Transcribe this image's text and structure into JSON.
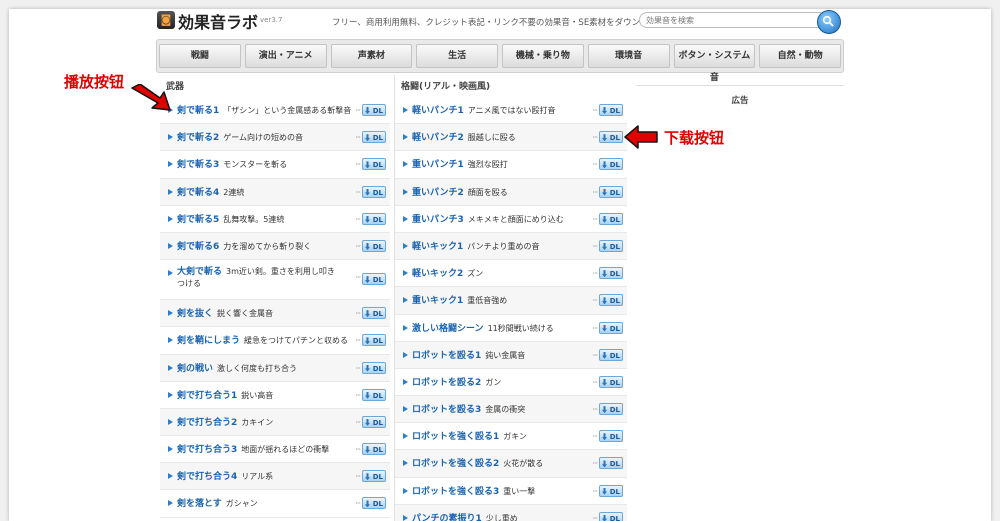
{
  "header": {
    "logo_glyph": "◙",
    "logo": "効果音ラボ",
    "version": "ver3.7",
    "tagline": "フリー、商用利用無料、クレジット表記・リンク不要の効果音・SE素材をダウンロード",
    "search_placeholder": "効果音を検索"
  },
  "nav": [
    "戦闘",
    "演出・アニメ",
    "声素材",
    "生活",
    "機械・乗り物",
    "環境音",
    "ボタン・システム音",
    "自然・動物"
  ],
  "col1": {
    "heading": "武器",
    "items": [
      {
        "title": "剣で斬る1",
        "desc": "「ザシン」という金属感ある斬撃音"
      },
      {
        "title": "剣で斬る2",
        "desc": "ゲーム向けの短めの音"
      },
      {
        "title": "剣で斬る3",
        "desc": "モンスターを斬る"
      },
      {
        "title": "剣で斬る4",
        "desc": "2連続"
      },
      {
        "title": "剣で斬る5",
        "desc": "乱舞攻撃。5連続"
      },
      {
        "title": "剣で斬る6",
        "desc": "力を溜めてから斬り裂く"
      },
      {
        "title": "大剣で斬る",
        "desc": "3m近い剣。重さを利用し叩きつける"
      },
      {
        "title": "剣を抜く",
        "desc": "鋭く響く金属音"
      },
      {
        "title": "剣を鞘にしまう",
        "desc": "緩急をつけてパチンと収める"
      },
      {
        "title": "剣の戦い",
        "desc": "激しく何度も打ち合う"
      },
      {
        "title": "剣で打ち合う1",
        "desc": "鋭い高音"
      },
      {
        "title": "剣で打ち合う2",
        "desc": "カキイン"
      },
      {
        "title": "剣で打ち合う3",
        "desc": "地面が揺れるほどの衝撃"
      },
      {
        "title": "剣で打ち合う4",
        "desc": "リアル系"
      },
      {
        "title": "剣を落とす",
        "desc": "ガシャン"
      }
    ]
  },
  "col2": {
    "heading": "格闘(リアル・映画風)",
    "items": [
      {
        "title": "軽いパンチ1",
        "desc": "アニメ風ではない殴打音"
      },
      {
        "title": "軽いパンチ2",
        "desc": "服越しに殴る"
      },
      {
        "title": "重いパンチ1",
        "desc": "強烈な殴打"
      },
      {
        "title": "重いパンチ2",
        "desc": "顔面を殴る"
      },
      {
        "title": "重いパンチ3",
        "desc": "メキメキと顔面にめり込む"
      },
      {
        "title": "軽いキック1",
        "desc": "パンチより重めの音"
      },
      {
        "title": "軽いキック2",
        "desc": "ズン"
      },
      {
        "title": "重いキック1",
        "desc": "重低音強め"
      },
      {
        "title": "激しい格闘シーン",
        "desc": "11秒間戦い続ける"
      },
      {
        "title": "ロボットを殴る1",
        "desc": "鈍い金属音"
      },
      {
        "title": "ロボットを殴る2",
        "desc": "ガン"
      },
      {
        "title": "ロボットを殴る3",
        "desc": "金属の衝突"
      },
      {
        "title": "ロボットを強く殴る1",
        "desc": "ガキン"
      },
      {
        "title": "ロボットを強く殴る2",
        "desc": "火花が散る"
      },
      {
        "title": "ロボットを強く殴る3",
        "desc": "重い一撃"
      },
      {
        "title": "パンチの素振り1",
        "desc": "少し重め"
      }
    ]
  },
  "dl_label": "DL",
  "dots": "···",
  "sidebar": {
    "ad_label": "広告"
  },
  "annotations": {
    "play": "播放按钮",
    "download": "下载按钮"
  },
  "colors": {
    "title_link": "#1a63b0",
    "annotation": "#e00000",
    "dl_button": "#a8d2f5"
  }
}
